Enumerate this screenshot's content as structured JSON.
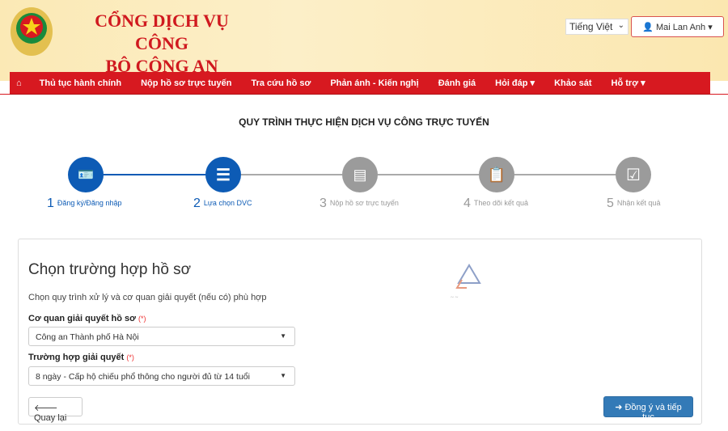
{
  "header": {
    "brand_line1": "CỔNG DỊCH VỤ CÔNG",
    "brand_line2": "BỘ CÔNG AN",
    "language": "Tiếng Việt",
    "user": "Mai Lan Anh"
  },
  "nav": {
    "items": [
      "Thủ tục hành chính",
      "Nộp hồ sơ trực tuyến",
      "Tra cứu hồ sơ",
      "Phản ánh - Kiến nghị",
      "Đánh giá",
      "Hỏi đáp ▾",
      "Khảo sát",
      "Hỗ trợ ▾"
    ]
  },
  "page_title": "QUY TRÌNH THỰC HIỆN DỊCH VỤ CÔNG TRỰC TUYẾN",
  "steps": [
    {
      "num": "1",
      "label": "Đăng ký/Đăng nhập",
      "state": "done"
    },
    {
      "num": "2",
      "label": "Lựa chọn DVC",
      "state": "active"
    },
    {
      "num": "3",
      "label": "Nộp hồ sơ trực tuyến",
      "state": "pending"
    },
    {
      "num": "4",
      "label": "Theo dõi kết quả",
      "state": "pending"
    },
    {
      "num": "5",
      "label": "Nhận kết quả",
      "state": "pending"
    }
  ],
  "colors": {
    "brand_red": "#d71920",
    "active_blue": "#0d5bb5",
    "inactive_gray": "#9b9b9b",
    "primary_button": "#337ab7"
  },
  "form": {
    "heading": "Chọn trường hợp hồ sơ",
    "description": "Chọn quy trình xử lý và cơ quan giải quyết (nếu có) phù hợp",
    "agency_label": "Cơ quan giải quyết hồ sơ",
    "required_mark": "(*)",
    "agency_value": "Công an Thành phố Hà Nội",
    "case_label": "Trường hợp giải quyết",
    "case_value": "8 ngày - Cấp hộ chiếu phổ thông cho người đủ từ 14 tuổi",
    "back_label": "Quay lại",
    "next_label": "Đồng ý và tiếp tục"
  }
}
